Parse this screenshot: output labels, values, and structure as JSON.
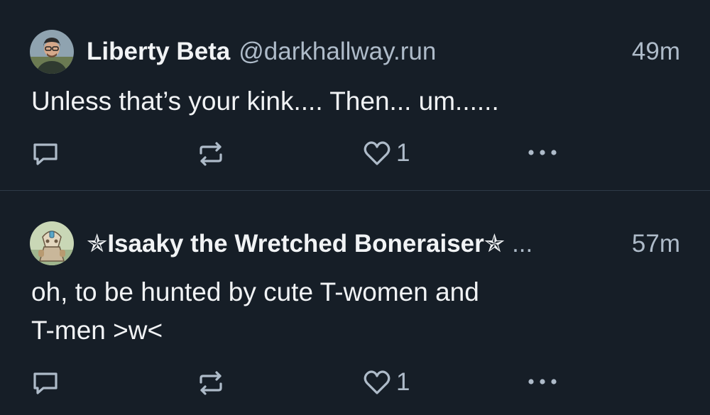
{
  "posts": [
    {
      "display_name": "Liberty Beta",
      "handle": "@darkhallway.run",
      "timestamp": "49m",
      "text": "Unless that’s your kink.... Then... um......",
      "like_count": "1",
      "avatar_icon": "person-with-glasses-avatar",
      "icons": [
        "reply-icon",
        "repost-icon",
        "heart-icon",
        "more-icon"
      ]
    },
    {
      "display_name": "✯Isaaky the Wretched Boneraiser✯",
      "name_truncation": "...",
      "timestamp": "57m",
      "text": "oh, to be hunted by cute T-women and\nT-men >w<",
      "like_count": "1",
      "avatar_icon": "game-character-avatar",
      "icons": [
        "reply-icon",
        "repost-icon",
        "heart-icon",
        "more-icon"
      ]
    }
  ],
  "colors": {
    "background": "#161e27",
    "primary_text": "#f1f3f5",
    "secondary_text": "#aebbc9",
    "divider": "#2e3a47"
  }
}
